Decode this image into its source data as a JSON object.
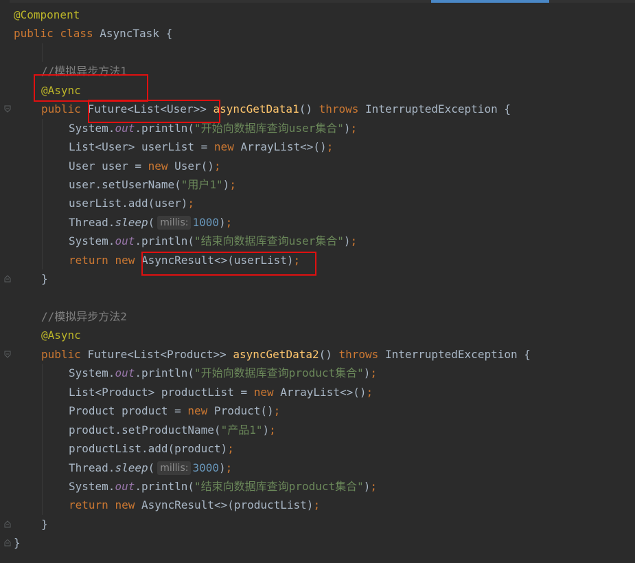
{
  "editor": {
    "accent_color": "#4a88c7",
    "highlight_color": "#e01010",
    "lines": {
      "l1_annotation": "@Component",
      "l2_kw_public": "public",
      "l2_kw_class": "class",
      "l2_name": "AsyncTask",
      "l2_brace": "{",
      "l4_comment": "//模拟异步方法1",
      "l5_annotation": "@Async",
      "l6_kw_public": "public",
      "l6_type": "Future<List<User>>",
      "l6_method": "asyncGetData1",
      "l6_parens": "()",
      "l6_kw_throws": "throws",
      "l6_exception": "InterruptedException {",
      "l7_a": "System.",
      "l7_out": "out",
      "l7_b": ".println(",
      "l7_str": "\"开始向数据库查询user集合\"",
      "l7_c": ")",
      "l8_a": "List<User> userList = ",
      "l8_new": "new",
      "l8_b": " ArrayList<>()",
      "l9_a": "User user = ",
      "l9_new": "new",
      "l9_b": " User()",
      "l10_a": "user.setUserName(",
      "l10_str": "\"用户1\"",
      "l10_b": ")",
      "l11_a": "userList.add(user)",
      "l12_a": "Thread.",
      "l12_sleep": "sleep",
      "l12_b": "(",
      "l12_hint": "millis:",
      "l12_num": "1000",
      "l12_c": ")",
      "l13_a": "System.",
      "l13_out": "out",
      "l13_b": ".println(",
      "l13_str": "\"结束向数据库查询user集合\"",
      "l13_c": ")",
      "l14_return": "return",
      "l14_new": "new",
      "l14_a": " AsyncResult<>(userList)",
      "l15_brace": "}",
      "l17_comment": "//模拟异步方法2",
      "l18_annotation": "@Async",
      "l19_kw_public": "public",
      "l19_type": "Future<List<Product>>",
      "l19_method": "asyncGetData2",
      "l19_parens": "()",
      "l19_kw_throws": "throws",
      "l19_exception": "InterruptedException {",
      "l20_a": "System.",
      "l20_out": "out",
      "l20_b": ".println(",
      "l20_str": "\"开始向数据库查询product集合\"",
      "l20_c": ")",
      "l21_a": "List<Product> productList = ",
      "l21_new": "new",
      "l21_b": " ArrayList<>()",
      "l22_a": "Product product = ",
      "l22_new": "new",
      "l22_b": " Product()",
      "l23_a": "product.setProductName(",
      "l23_str": "\"产品1\"",
      "l23_b": ")",
      "l24_a": "productList.add(product)",
      "l25_a": "Thread.",
      "l25_sleep": "sleep",
      "l25_b": "(",
      "l25_hint": "millis:",
      "l25_num": "3000",
      "l25_c": ")",
      "l26_a": "System.",
      "l26_out": "out",
      "l26_b": ".println(",
      "l26_str": "\"结束向数据库查询product集合\"",
      "l26_c": ")",
      "l27_return": "return",
      "l27_new": "new",
      "l27_a": " AsyncResult<>(productList)",
      "l28_brace": "}",
      "l29_brace": "}",
      "semicolon": ";"
    }
  }
}
